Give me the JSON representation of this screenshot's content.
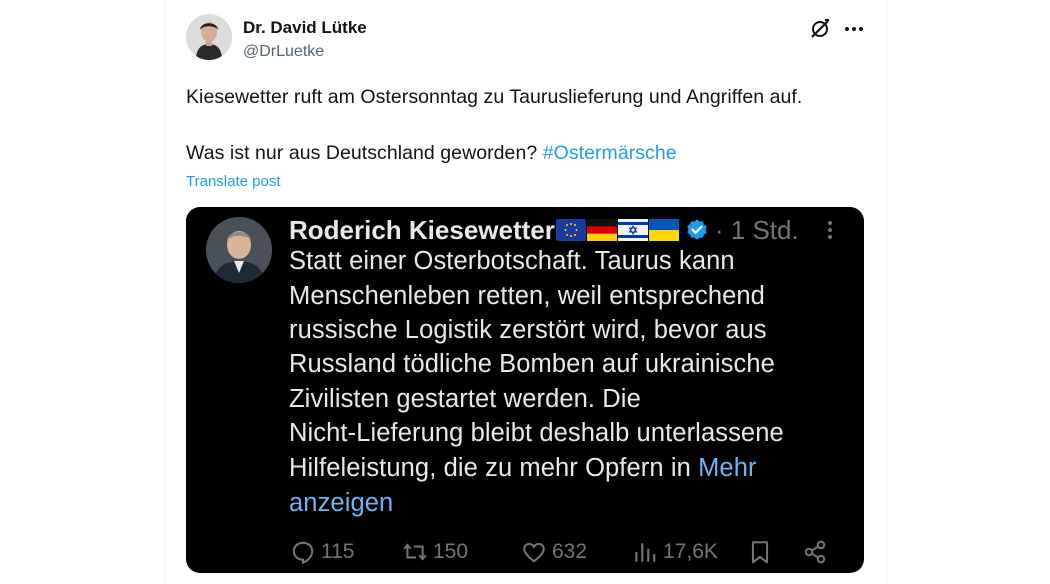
{
  "post": {
    "author_name": "Dr. David Lütke",
    "author_handle": "@DrLuetke",
    "text_line1": "Kiesewetter ruft am Ostersonntag zu Tauruslieferung und Angriffen auf.",
    "text_line2": "Was ist nur aus Deutschland geworden?",
    "hashtag": "#Ostermärsche",
    "translate_label": "Translate post",
    "icons": {
      "grok": "grok-icon",
      "more": "more-dots-icon"
    }
  },
  "screenshot": {
    "author_name": "Roderich Kiesewetter",
    "flags": [
      "eu-flag",
      "germany-flag",
      "israel-flag",
      "ukraine-flag"
    ],
    "verified": "verified-badge-icon",
    "time": "· 1 Std.",
    "text_lines": [
      "Statt einer Osterbotschaft. Taurus kann",
      "Menschenleben retten, weil entsprechend",
      "russische Logistik zerstört wird, bevor aus",
      "Russland tödliche Bomben auf ukrainische",
      "Zivilisten gestartet werden. Die",
      "Nicht-Lieferung bleibt deshalb unterlassene",
      "Hilfeleistung, die zu mehr Opfern in"
    ],
    "more_part1": "Mehr",
    "more_part2": "anzeigen",
    "actions": {
      "replies": "115",
      "reposts": "150",
      "likes": "632",
      "views": "17,6K"
    },
    "colors": {
      "background": "#000000",
      "text": "#e7e9ea",
      "muted": "#71767b",
      "link": "#6cb4f4",
      "verified": "#1d9bf0"
    }
  },
  "colors": {
    "accent": "#1d9bf0",
    "text": "#0f1419",
    "muted": "#536471"
  }
}
